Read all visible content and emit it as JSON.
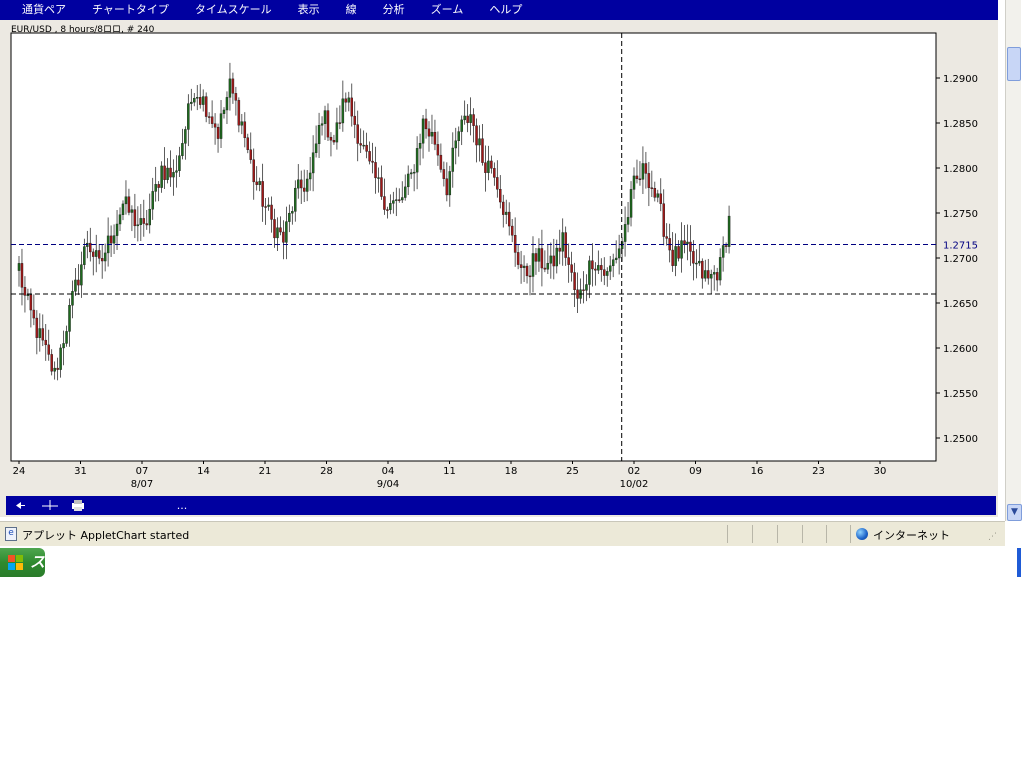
{
  "menu": [
    "通貨ペア",
    "チャートタイプ",
    "タイムスケール",
    "表示",
    "線",
    "分析",
    "ズーム",
    "ヘルプ"
  ],
  "colors": {
    "up": "#1e6a1e",
    "down": "#a01818",
    "menubar": "#0000a0",
    "crosshair_h": "#000080"
  },
  "chart_data": {
    "type": "candlestick",
    "title": "EUR/USD , 8 hours/8ロロ, # 240",
    "ylim": [
      1.2475,
      1.2955
    ],
    "yticks": [
      1.25,
      1.255,
      1.26,
      1.265,
      1.27,
      1.275,
      1.28,
      1.285,
      1.29
    ],
    "ytick_labels": [
      "1.2500",
      "1.2550",
      "1.2600",
      "1.2650",
      "1.2700",
      "1.2750",
      "1.2800",
      "1.2850",
      "1.2900"
    ],
    "xticks": [
      "24",
      "31",
      "07",
      "14",
      "21",
      "28",
      "04",
      "11",
      "18",
      "25",
      "02",
      "09",
      "16",
      "23",
      "30"
    ],
    "month_labels": [
      {
        "at_tick": 2,
        "label": "8/07"
      },
      {
        "at_tick": 6,
        "label": "9/04"
      },
      {
        "at_tick": 10,
        "label": "10/02"
      }
    ],
    "bars_per_tick": 20.7,
    "crosshair": {
      "price": 1.2715,
      "label": "1.2715",
      "at_tick": 9.8
    },
    "reference_line": 1.266,
    "grid": false,
    "candles": 240,
    "close_anchors": [
      [
        0,
        1.269
      ],
      [
        2,
        1.2655
      ],
      [
        6,
        1.262
      ],
      [
        12,
        1.257
      ],
      [
        17,
        1.264
      ],
      [
        23,
        1.272
      ],
      [
        27,
        1.269
      ],
      [
        35,
        1.276
      ],
      [
        42,
        1.273
      ],
      [
        48,
        1.28
      ],
      [
        52,
        1.279
      ],
      [
        55,
        1.283
      ],
      [
        59,
        1.289
      ],
      [
        63,
        1.287
      ],
      [
        67,
        1.284
      ],
      [
        71,
        1.289
      ],
      [
        75,
        1.285
      ],
      [
        79,
        1.279
      ],
      [
        85,
        1.274
      ],
      [
        89,
        1.272
      ],
      [
        93,
        1.277
      ],
      [
        98,
        1.279
      ],
      [
        102,
        1.286
      ],
      [
        106,
        1.283
      ],
      [
        110,
        1.288
      ],
      [
        114,
        1.284
      ],
      [
        118,
        1.28
      ],
      [
        124,
        1.276
      ],
      [
        128,
        1.276
      ],
      [
        132,
        1.279
      ],
      [
        136,
        1.285
      ],
      [
        140,
        1.283
      ],
      [
        144,
        1.278
      ],
      [
        148,
        1.284
      ],
      [
        152,
        1.286
      ],
      [
        156,
        1.281
      ],
      [
        160,
        1.28
      ],
      [
        165,
        1.273
      ],
      [
        170,
        1.268
      ],
      [
        174,
        1.27
      ],
      [
        179,
        1.269
      ],
      [
        183,
        1.272
      ],
      [
        188,
        1.265
      ],
      [
        193,
        1.27
      ],
      [
        198,
        1.268
      ],
      [
        203,
        1.272
      ],
      [
        207,
        1.278
      ],
      [
        211,
        1.28
      ],
      [
        215,
        1.276
      ],
      [
        220,
        1.27
      ],
      [
        224,
        1.271
      ],
      [
        228,
        1.269
      ],
      [
        232,
        1.2675
      ],
      [
        236,
        1.269
      ],
      [
        240,
        1.276
      ]
    ]
  },
  "toolbar": {
    "more_label": "..."
  },
  "status": {
    "message": "アプレット AppletChart started",
    "zone": "インターネット"
  },
  "taskbar": {
    "start_label": "スタート"
  }
}
